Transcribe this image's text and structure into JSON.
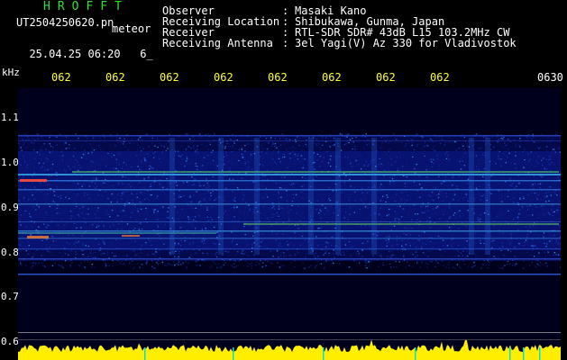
{
  "header": {
    "app_title": "HROFFT",
    "filename": "UT2504250620.pn",
    "meteor_label": "meteor",
    "datetime": "25.04.25 06:20",
    "datetime_suffix": "6_"
  },
  "info": {
    "rows": [
      {
        "label": "Observer",
        "value": "Masaki Kano"
      },
      {
        "label": "Receiving Location",
        "value": "Shibukawa, Gunma, Japan"
      },
      {
        "label": "Receiver",
        "value": "RTL-SDR SDR# 43dB L15 103.2MHz CW"
      },
      {
        "label": "Receiving Antenna",
        "value": "3el Yagi(V) Az 330 for Vladivostok"
      }
    ]
  },
  "y_axis": {
    "unit": "kHz",
    "ticks": [
      "1.1",
      "1.0",
      "0.9",
      "0.8",
      "0.7",
      "0.6"
    ]
  },
  "x_axis": {
    "ticks": [
      "062",
      "062",
      "062",
      "062",
      "062",
      "062",
      "062",
      "062",
      "0630"
    ]
  },
  "colors": {
    "title_green": "#2fe02f",
    "tick_yellow": "#ffff33",
    "background": "#000000"
  }
}
